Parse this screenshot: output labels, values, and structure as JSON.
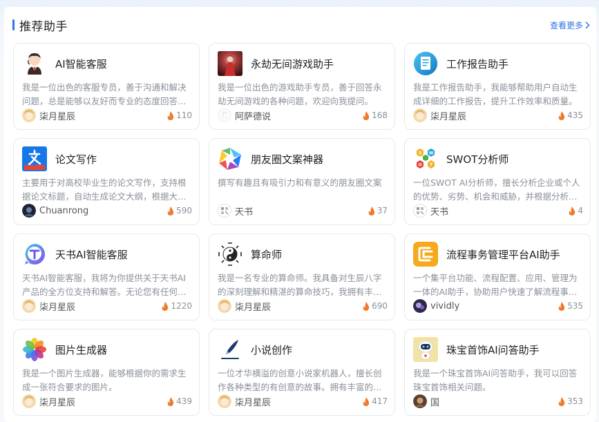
{
  "header": {
    "title": "推荐助手",
    "more_label": "查看更多"
  },
  "colors": {
    "accent": "#2f74e6",
    "flame": "#f07a2c"
  },
  "cards": [
    {
      "name": "AI智能客服",
      "desc": "我是一位出色的客服专员，善于沟通和解决问题，总是能够以友好而专业的态度回答用户的问题。",
      "author": "柒月星辰",
      "count": "110",
      "icon": "customer-service-avatar",
      "author_icon": "anime-girl-avatar"
    },
    {
      "name": "永劫无间游戏助手",
      "desc": "我是一位出色的游戏助手专员，善于回答永劫无间游戏的各种问题，欢迎向我提问。",
      "author": "阿萨德说",
      "count": "168",
      "icon": "game-character-avatar",
      "author_icon": "default-avatar"
    },
    {
      "name": "工作报告助手",
      "desc": "我是工作报告助手，我能够帮助用户自动生成详细的工作报告，提升工作效率和质量。",
      "author": "柒月星辰",
      "count": "435",
      "icon": "report-document-icon",
      "author_icon": "anime-girl-avatar"
    },
    {
      "name": "论文写作",
      "desc": "主要用于对高校毕业生的论文写作，支持根据论文标题，自动生成论文大纲，根据大纲生成内容。",
      "author": "Chuanrong",
      "count": "590",
      "icon": "thesis-writing-icon",
      "author_icon": "dark-avatar"
    },
    {
      "name": "朋友圈文案神器",
      "desc": "撰写有趣且有吸引力和有意义的朋友圈文案",
      "author": "天书",
      "count": "37",
      "icon": "aperture-icon",
      "author_icon": "qr-avatar"
    },
    {
      "name": "SWOT分析师",
      "desc": "一位SWOT AI分析师，擅长分析企业或个人的优势、劣势、机会和威胁，并根据分析结果给出建议。",
      "author": "天书",
      "count": "4",
      "icon": "swot-hexagon-icon",
      "author_icon": "qr-avatar"
    },
    {
      "name": "天书AI智能客服",
      "desc": "天书AI智能客服，我将为你提供关于天书AI产品的全方位支持和解答。无论您有任何问题，我都能帮您解决。",
      "author": "柒月星辰",
      "count": "1220",
      "icon": "tianshu-chat-icon",
      "author_icon": "anime-girl-avatar"
    },
    {
      "name": "算命师",
      "desc": "我是一名专业的算命师。我具备对生辰八字的深刻理解和精湛的算命技巧，我拥有丰富的经验。",
      "author": "柒月星辰",
      "count": "690",
      "icon": "yin-yang-icon",
      "author_icon": "anime-girl-avatar"
    },
    {
      "name": "流程事务管理平台AI助手",
      "desc": "一个集平台功能、流程配置、应用、管理为一体的AI助手，协助用户快速了解流程事务管理平台。",
      "author": "vividly",
      "count": "535",
      "icon": "workflow-icon",
      "author_icon": "purple-avatar"
    },
    {
      "name": "图片生成器",
      "desc": "我是一个图片生成器，能够根据你的需求生成一张符合要求的图片。",
      "author": "柒月星辰",
      "count": "439",
      "icon": "photos-flower-icon",
      "author_icon": "anime-girl-avatar"
    },
    {
      "name": "小说创作",
      "desc": "一位才华横溢的创意小说家机器人，擅长创作各种类型的有创意的故事。拥有丰富的想象力和创作经验。",
      "author": "柒月星辰",
      "count": "417",
      "icon": "pen-icon",
      "author_icon": "anime-girl-avatar"
    },
    {
      "name": "珠宝首饰AI问答助手",
      "desc": "我是一个珠宝首饰AI问答助手，我可以回答珠宝首饰相关问题。",
      "author": "国",
      "count": "353",
      "icon": "robot-icon",
      "author_icon": "brown-avatar"
    }
  ]
}
